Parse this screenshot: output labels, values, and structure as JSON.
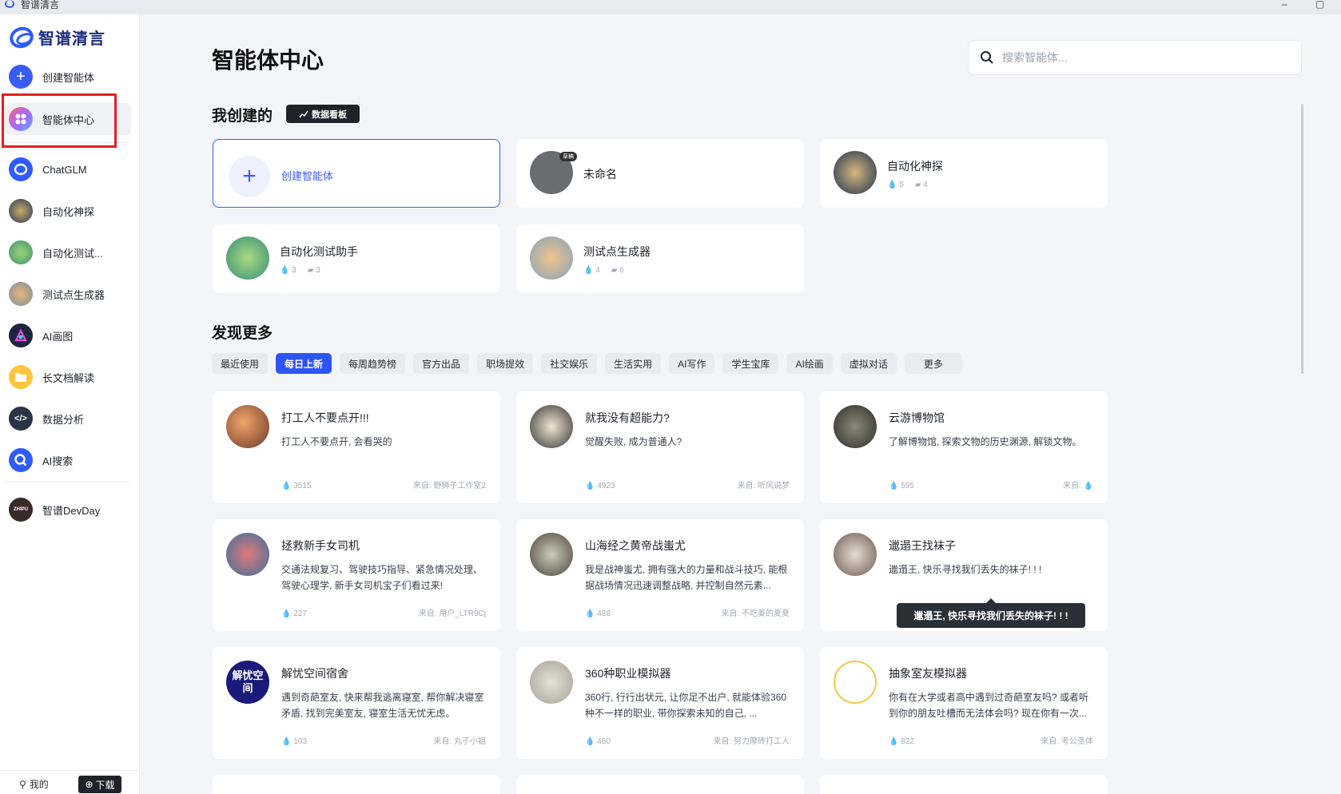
{
  "window": {
    "title": "智谱清言",
    "minimize": "–",
    "maximize": "▢"
  },
  "brand": {
    "name": "智谱清言"
  },
  "sidebar": {
    "items": [
      {
        "label": "创建智能体"
      },
      {
        "label": "智能体中心"
      },
      {
        "label": "ChatGLM"
      },
      {
        "label": "自动化神探"
      },
      {
        "label": "自动化测试..."
      },
      {
        "label": "测试点生成器"
      },
      {
        "label": "AI画图"
      },
      {
        "label": "长文档解读"
      },
      {
        "label": "数据分析"
      },
      {
        "label": "AI搜索"
      },
      {
        "label": "智谱DevDay"
      }
    ],
    "mine": "我的",
    "download": "下载"
  },
  "main": {
    "title": "智能体中心",
    "search_placeholder": "搜索智能体...",
    "my_section": "我创建的",
    "dashboard_btn": "数据看板",
    "create_label": "创建智能体",
    "my_agents": [
      {
        "name": "未命名",
        "badge": "草稿"
      },
      {
        "name": "自动化神探",
        "likes": "5",
        "chats": "4"
      },
      {
        "name": "自动化测试助手",
        "likes": "3",
        "chats": "3"
      },
      {
        "name": "测试点生成器",
        "likes": "4",
        "chats": "6"
      }
    ],
    "discover_section": "发现更多",
    "tabs": [
      "最近使用",
      "每日上新",
      "每周趋势榜",
      "官方出品",
      "职场提效",
      "社交娱乐",
      "生活实用",
      "AI写作",
      "学生宝库",
      "AI绘画",
      "虚拟对话",
      "更多"
    ],
    "agents": [
      {
        "name": "打工人不要点开!!!",
        "desc": "打工人不要点开, 会看哭的",
        "count": "3515",
        "source": "来自: 野狮子工作室2"
      },
      {
        "name": "就我没有超能力?",
        "desc": "觉醒失败, 成为普通人?",
        "count": "4923",
        "source": "来自: 听风说梦"
      },
      {
        "name": "云游博物馆",
        "desc": "了解博物馆, 探索文物的历史渊源, 解锁文物。",
        "count": "595",
        "source": "来自:"
      },
      {
        "name": "拯救新手女司机",
        "desc": "交通法规复习、驾驶技巧指导、紧急情况处理、驾驶心理学, 新手女司机宝子们看过来!",
        "count": "227",
        "source": "来自: 用户_LTR9Cj"
      },
      {
        "name": "山海经之黄帝战蚩尤",
        "desc": "我是战神蚩尤, 拥有强大的力量和战斗技巧, 能根据战场情况迅速调整战略, 并控制自然元素...",
        "count": "488",
        "source": "来自: 不吃姜的夏夏"
      },
      {
        "name": "邋遢王找袜子",
        "desc": "邋遢王, 快乐寻找我们丢失的袜子! ! !",
        "count": "",
        "source": ""
      },
      {
        "name": "解忧空间宿舍",
        "desc": "遇到奇葩室友, 快来帮我逃离寝室, 帮你解决寝室矛盾, 找到完美室友, 寝室生活无忧无虑。",
        "count": "103",
        "source": "来自: 丸子小姐"
      },
      {
        "name": "360种职业模拟器",
        "desc": "360行, 行行出状元, 让你足不出户, 就能体验360种不一样的职业, 带你探索未知的自己, ...",
        "count": "460",
        "source": "来自: 努力摩砖打工人"
      },
      {
        "name": "抽象室友模拟器",
        "desc": "你有在大学或者高中遇到过奇葩室友吗? 或者听到你的朋友吐槽而无法体会吗? 现在你有一次...",
        "count": "822",
        "source": "来自: 考公圣体"
      }
    ],
    "tooltip": "邋遢王, 快乐寻找我们丢失的袜子! ! !",
    "avatar_text": {
      "jieyou": "解忧空间"
    }
  },
  "colors": {
    "accent": "#2e54f5",
    "highlight": "#e02020"
  }
}
